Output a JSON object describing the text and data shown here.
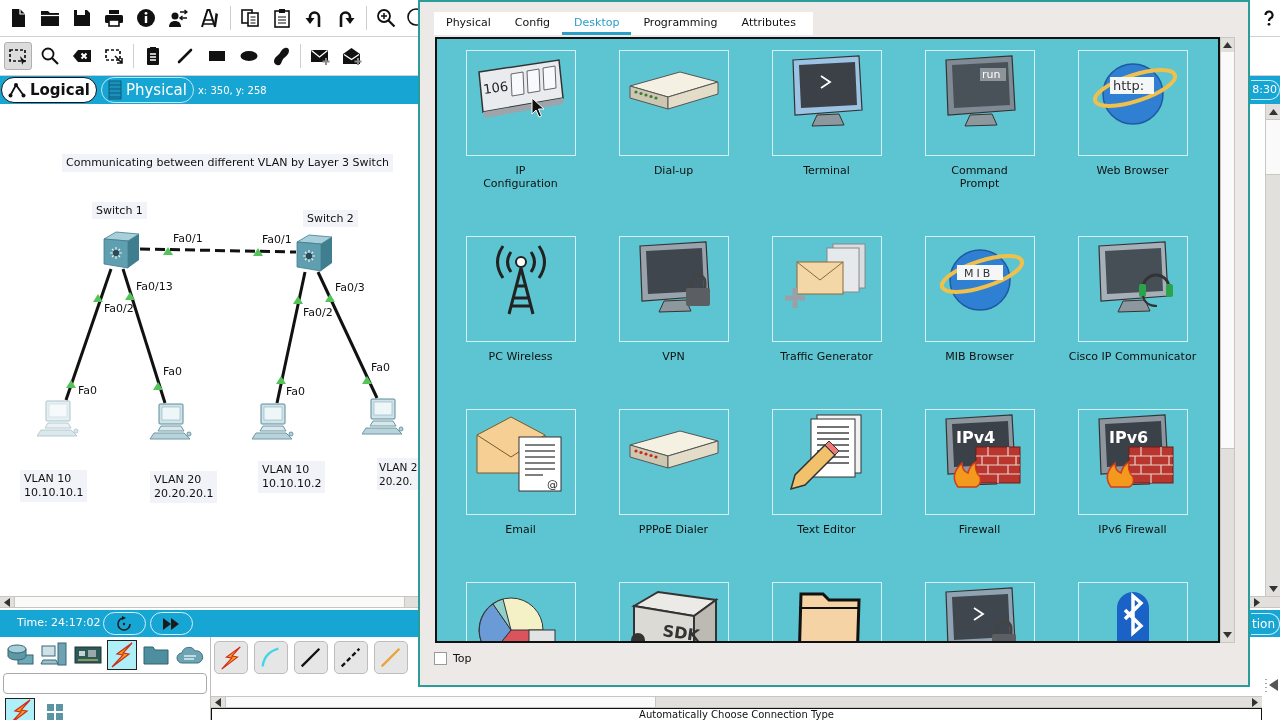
{
  "toolbar": {
    "tools": [
      {
        "selected": true
      },
      {
        "selected": false
      },
      {
        "selected": false
      },
      {
        "selected": false
      },
      {
        "selected": false
      },
      {
        "selected": false
      },
      {
        "selected": false
      },
      {
        "selected": false
      },
      {
        "selected": false
      },
      {
        "selected": false
      },
      {
        "selected": false
      }
    ]
  },
  "view_tabs": [
    {
      "label": "Logical",
      "selected": true
    },
    {
      "label": "Physical",
      "selected": false
    }
  ],
  "cursor_position": "x: 350, y: 258",
  "clock": "8:30",
  "diagram": {
    "notes": [
      {
        "text": "Communicating between different VLAN by Layer 3 Switch"
      },
      {
        "text": "VLAN 10\n10.10.10.1"
      },
      {
        "text": "VLAN 20\n20.20.20.1"
      },
      {
        "text": "VLAN 10\n10.10.10.2"
      },
      {
        "text": "VLAN 2\n20.20."
      }
    ],
    "devices": [
      {
        "kind": "switch",
        "label": "Switch 1"
      },
      {
        "kind": "switch",
        "label": "Switch 2"
      },
      {
        "kind": "pc",
        "dimmed": true
      },
      {
        "kind": "pc",
        "dimmed": false
      },
      {
        "kind": "pc",
        "dimmed": false
      },
      {
        "kind": "pc",
        "dimmed": false
      }
    ],
    "links": [
      {
        "kind": "crossover",
        "ends": [
          {
            "port": "Fa0/1",
            "up": true
          },
          {
            "port": "Fa0/1",
            "up": true
          }
        ]
      },
      {
        "kind": "straight",
        "ends": [
          {
            "port": "Fa0/2",
            "up": true
          },
          {
            "port": "Fa0",
            "up": true
          }
        ]
      },
      {
        "kind": "straight",
        "ends": [
          {
            "port": "Fa0/13",
            "up": true
          },
          {
            "port": "Fa0",
            "up": true
          }
        ]
      },
      {
        "kind": "straight",
        "ends": [
          {
            "port": "Fa0/2",
            "up": true
          },
          {
            "port": "Fa0",
            "up": true
          }
        ]
      },
      {
        "kind": "straight",
        "ends": [
          {
            "port": "Fa0/3",
            "up": true
          },
          {
            "port": "Fa0",
            "up": true
          }
        ]
      }
    ]
  },
  "simulation_bar": {
    "time": "Time: 24:17:02",
    "mode": "tion"
  },
  "device_categories": [
    {
      "selected": false
    },
    {
      "selected": false
    },
    {
      "selected": false
    },
    {
      "selected": true
    },
    {
      "selected": false
    },
    {
      "selected": false
    }
  ],
  "device_subcategories": [
    {
      "selected": true
    },
    {
      "selected": false
    }
  ],
  "connection_types": [
    {
      "kind": "auto"
    },
    {
      "kind": "console"
    },
    {
      "kind": "straight"
    },
    {
      "kind": "crossover"
    },
    {
      "kind": "fiber"
    }
  ],
  "connection_hint": "Automatically Choose Connection Type",
  "dialog": {
    "tabs": [
      {
        "label": "Physical",
        "selected": false
      },
      {
        "label": "Config",
        "selected": false
      },
      {
        "label": "Desktop",
        "selected": true
      },
      {
        "label": "Programming",
        "selected": false
      },
      {
        "label": "Attributes",
        "selected": false
      }
    ],
    "apps": [
      {
        "kind": "ip-config",
        "label": "IP\nConfiguration",
        "icon_text": "106"
      },
      {
        "kind": "dial-up",
        "label": "Dial-up"
      },
      {
        "kind": "terminal",
        "label": "Terminal"
      },
      {
        "kind": "command-prompt",
        "label": "Command\nPrompt",
        "icon_text": "run"
      },
      {
        "kind": "web-browser",
        "label": "Web Browser",
        "icon_text": "http:"
      },
      {
        "kind": "pc-wireless",
        "label": "PC Wireless"
      },
      {
        "kind": "vpn",
        "label": "VPN"
      },
      {
        "kind": "traffic-generator",
        "label": "Traffic Generator"
      },
      {
        "kind": "mib-browser",
        "label": "MIB Browser",
        "icon_text": "MIB"
      },
      {
        "kind": "ip-communicator",
        "label": "Cisco IP Communicator"
      },
      {
        "kind": "email",
        "label": "Email",
        "icon_text": "@"
      },
      {
        "kind": "pppoe-dialer",
        "label": "PPPoE Dialer"
      },
      {
        "kind": "text-editor",
        "label": "Text Editor"
      },
      {
        "kind": "firewall",
        "label": "Firewall",
        "icon_text": "IPv4"
      },
      {
        "kind": "firewall",
        "label": "IPv6 Firewall",
        "icon_text": "IPv6"
      },
      {
        "kind": "pie-chart"
      },
      {
        "kind": "sdk",
        "icon_text": "SDK"
      },
      {
        "kind": "folder"
      },
      {
        "kind": "terminal-lock"
      },
      {
        "kind": "bluetooth"
      }
    ],
    "top_checkbox": {
      "label": "Top",
      "checked": false
    }
  }
}
